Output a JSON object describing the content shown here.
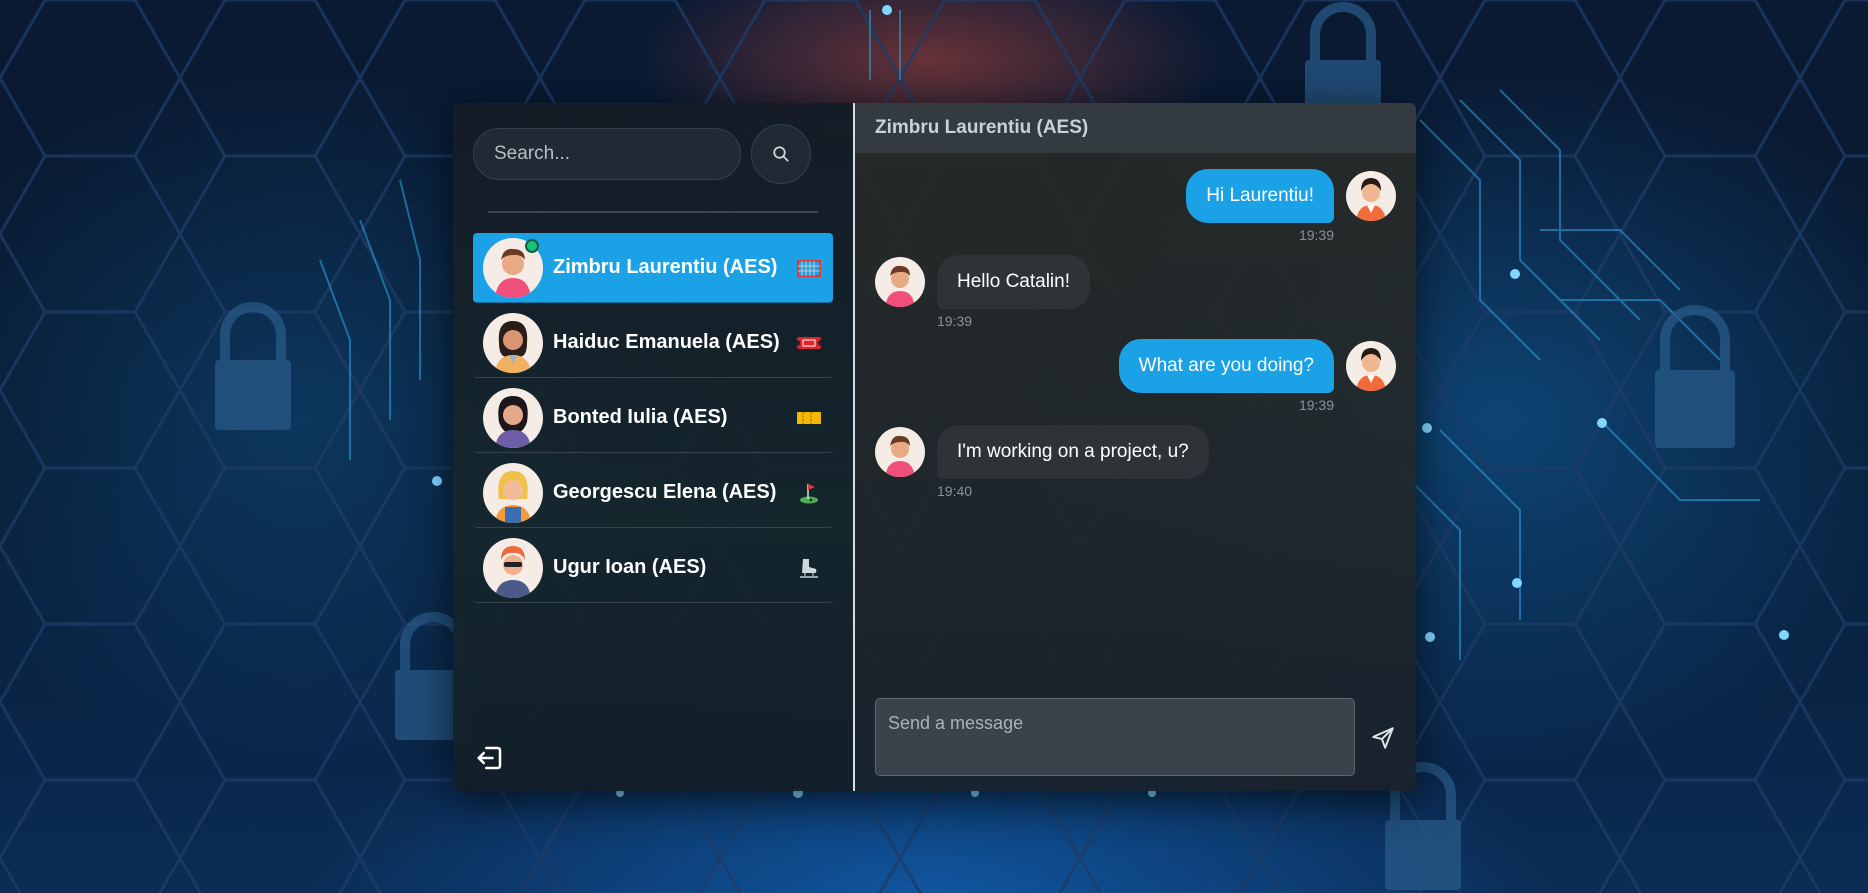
{
  "search": {
    "placeholder": "Search..."
  },
  "contacts": [
    {
      "name": "Zimbru Laurentiu (AES)",
      "icon": "goal-net-icon",
      "active": true,
      "online": true
    },
    {
      "name": "Haiduc Emanuela (AES)",
      "icon": "ticket-icon",
      "active": false
    },
    {
      "name": "Bonted Iulia (AES)",
      "icon": "admission-tickets-icon",
      "active": false
    },
    {
      "name": "Georgescu Elena (AES)",
      "icon": "golf-flag-icon",
      "active": false
    },
    {
      "name": "Ugur Ioan (AES)",
      "icon": "ice-skate-icon",
      "active": false
    }
  ],
  "chat": {
    "title": "Zimbru Laurentiu (AES)",
    "messages": [
      {
        "direction": "out",
        "text": "Hi Laurentiu!",
        "time": "19:39"
      },
      {
        "direction": "in",
        "text": "Hello Catalin!",
        "time": "19:39"
      },
      {
        "direction": "out",
        "text": "What are you doing?",
        "time": "19:39"
      },
      {
        "direction": "in",
        "text": "I'm working on a project, u?",
        "time": "19:40"
      }
    ]
  },
  "composer": {
    "placeholder": "Send a message"
  },
  "colors": {
    "accent": "#1aa1e6",
    "online": "#19c27a",
    "bubble_in": "#2e3338"
  }
}
